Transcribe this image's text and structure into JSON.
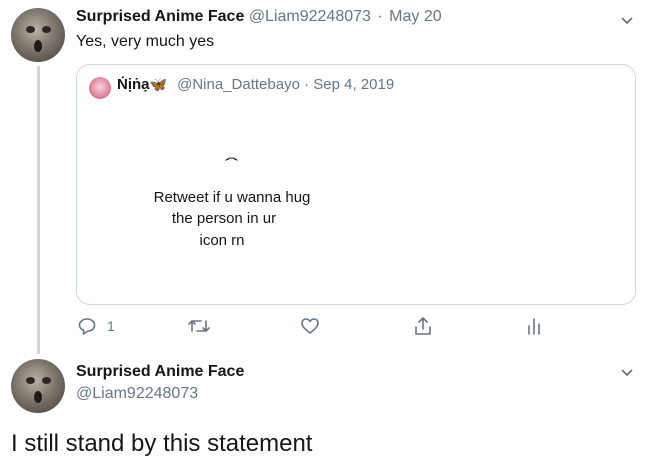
{
  "tweet1": {
    "author_name": "Surprised Anime Face",
    "handle": "@Liam92248073",
    "separator": "·",
    "date": "May 20",
    "text": "Yes, very much yes"
  },
  "quoted": {
    "display_name": "Ṅịṅạ",
    "emoji": "🦋",
    "handle": "@Nina_Dattebayo",
    "separator": "·",
    "date": "Sep 4, 2019",
    "face": ". .\n⌒",
    "line1": "Retweet if u wanna hug",
    "line2": "the person in ur",
    "line3": "icon rn"
  },
  "actions": {
    "reply_count": "1"
  },
  "tweet2": {
    "author_name": "Surprised Anime Face",
    "handle": "@Liam92248073",
    "text": "I still stand by this statement"
  },
  "colors": {
    "accent": "#1da1f2",
    "muted": "#657786",
    "border": "#ccd6dd"
  },
  "icons": [
    "chevron-down-icon",
    "reply-icon",
    "retweet-icon",
    "like-icon",
    "share-icon",
    "analytics-icon"
  ]
}
